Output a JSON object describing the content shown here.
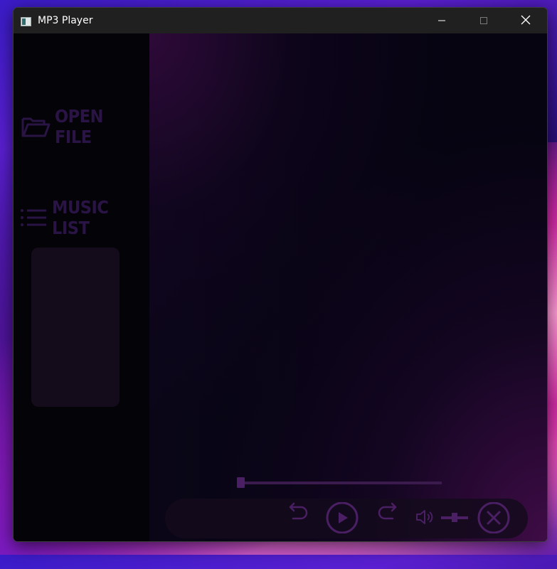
{
  "window": {
    "title": "MP3 Player"
  },
  "sidebar": {
    "open_file_label": "OPEN FILE",
    "music_list_label": "MUSIC LIST"
  },
  "player": {
    "progress": 0.0,
    "volume": 0.5
  },
  "colors": {
    "accent": "#4a1f63",
    "sidebar_text": "#2a1445",
    "titlebar": "#202020",
    "background": "#050410"
  },
  "icons": {
    "app": "app-icon",
    "minimize": "minimize-icon",
    "maximize": "maximize-icon",
    "close": "close-icon",
    "open_file": "folder-open-icon",
    "music_list": "list-icon",
    "rewind": "undo-arrow-icon",
    "play": "play-icon",
    "forward": "redo-arrow-icon",
    "volume": "speaker-icon",
    "stop": "close-circle-icon"
  }
}
